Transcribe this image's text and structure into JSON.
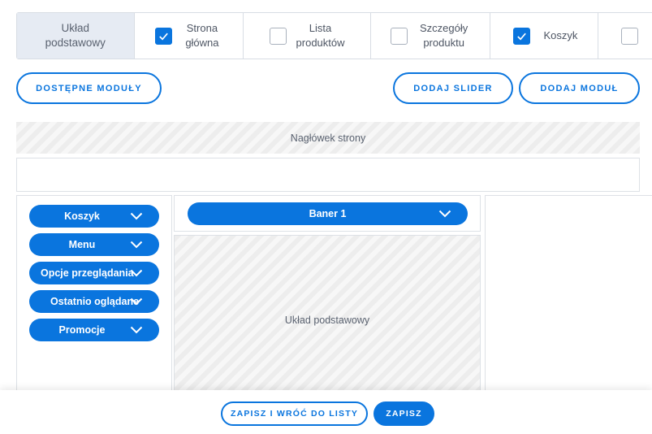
{
  "tabs": [
    {
      "label": "Układ podstawowy",
      "checked": null
    },
    {
      "label": "Strona główna",
      "checked": true
    },
    {
      "label": "Lista produktów",
      "checked": false
    },
    {
      "label": "Szczegóły produktu",
      "checked": false
    },
    {
      "label": "Koszyk",
      "checked": true
    },
    {
      "label": "",
      "checked": false
    }
  ],
  "toolbar": {
    "available_modules": "DOSTĘPNE MODUŁY",
    "add_slider": "DODAJ SLIDER",
    "add_module": "DODAJ MODUŁ"
  },
  "layout": {
    "header_zone": "Nagłówek strony",
    "main_zone": "Układ podstawowy"
  },
  "left_modules": [
    "Koszyk",
    "Menu",
    "Opcje przeglądania",
    "Ostatnio oglądane",
    "Promocje"
  ],
  "center_modules": [
    "Baner 1"
  ],
  "footer": {
    "save_and_back": "ZAPISZ I WRÓĆ DO LISTY",
    "save": "ZAPISZ"
  },
  "colors": {
    "accent": "#0a75de",
    "active_tab": "#e6ebf3"
  }
}
